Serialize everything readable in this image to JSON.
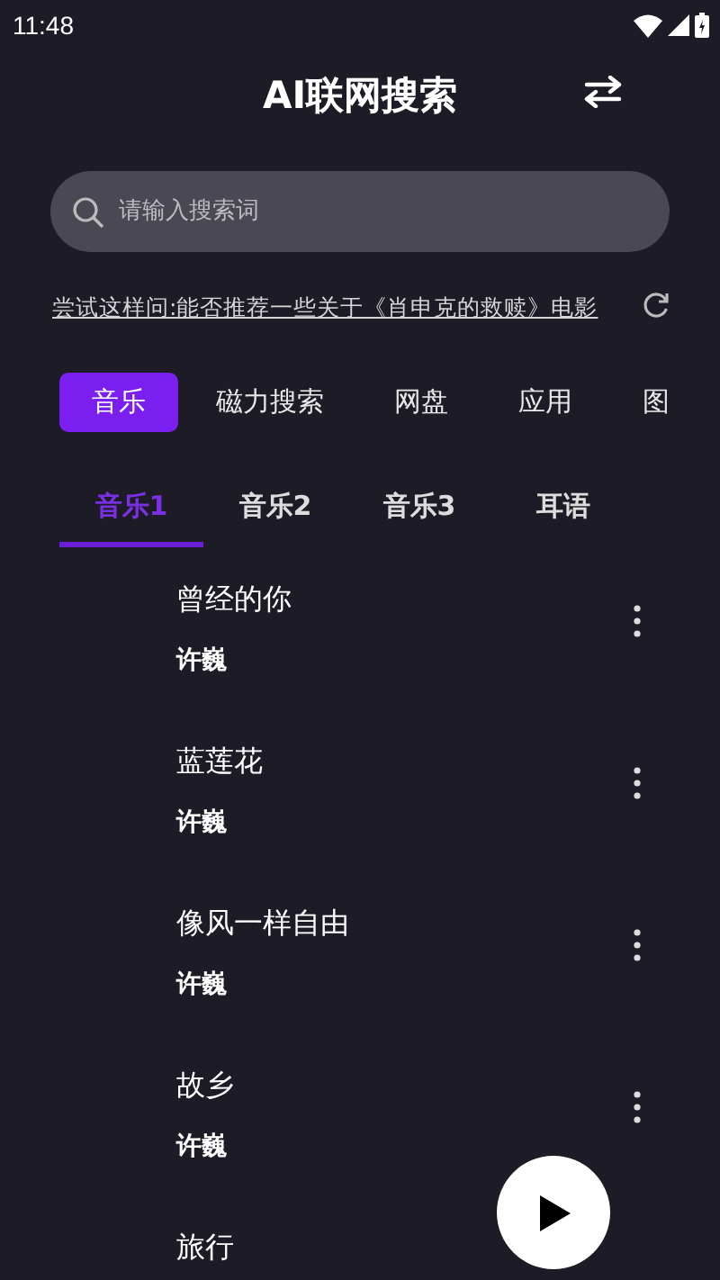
{
  "status_bar": {
    "time": "11:48"
  },
  "header": {
    "title": "AI联网搜索"
  },
  "search": {
    "placeholder": "请输入搜索词"
  },
  "suggestion": {
    "text": "尝试这样问:能否推荐一些关于《肖申克的救赎》电影"
  },
  "categories": [
    {
      "label": "音乐",
      "selected": true
    },
    {
      "label": "磁力搜索",
      "selected": false
    },
    {
      "label": "网盘",
      "selected": false
    },
    {
      "label": "应用",
      "selected": false
    },
    {
      "label": "图",
      "selected": false
    }
  ],
  "sub_tabs": [
    {
      "label": "音乐1",
      "selected": true
    },
    {
      "label": "音乐2",
      "selected": false
    },
    {
      "label": "音乐3",
      "selected": false
    },
    {
      "label": "耳语",
      "selected": false
    }
  ],
  "songs": [
    {
      "title": "曾经的你",
      "artist": "许巍",
      "menu": true
    },
    {
      "title": "蓝莲花",
      "artist": "许巍",
      "menu": true
    },
    {
      "title": "像风一样自由",
      "artist": "许巍",
      "menu": true
    },
    {
      "title": "故乡",
      "artist": "许巍",
      "menu": true
    },
    {
      "title": "旅行",
      "menu": false
    }
  ]
}
